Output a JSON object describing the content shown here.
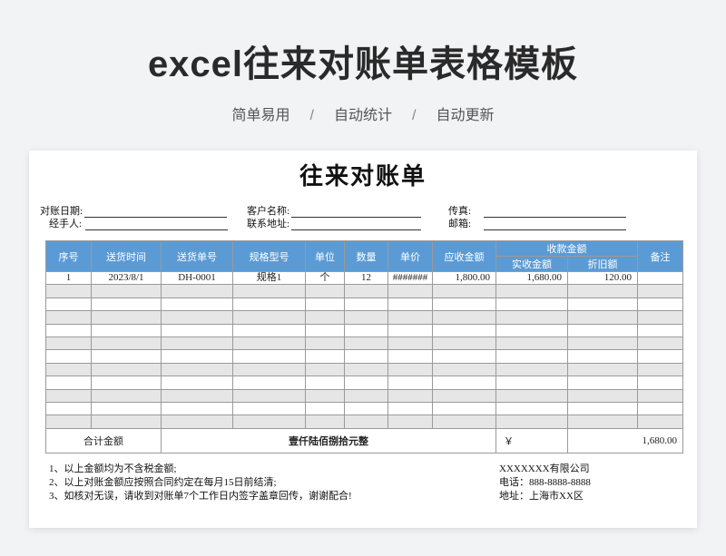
{
  "hero": {
    "title": "excel往来对账单表格模板",
    "tags": [
      "简单易用",
      "自动统计",
      "自动更新"
    ],
    "separator": "/"
  },
  "doc": {
    "title": "往来对账单",
    "fields": {
      "date_label": "对账日期:",
      "customer_label": "客户名称:",
      "fax_label": "传真:",
      "handler_label": "经手人:",
      "address_label": "联系地址:",
      "email_label": "邮箱:"
    }
  },
  "table": {
    "headers": {
      "index": "序号",
      "ship_time": "送货时间",
      "ship_no": "送货单号",
      "spec": "规格型号",
      "unit": "单位",
      "qty": "数量",
      "price": "单价",
      "receivable": "应收金额",
      "received_group": "收款金额",
      "actual": "实收金额",
      "discount": "折旧额",
      "remark": "备注"
    },
    "rows": [
      [
        "1",
        "2023/8/1",
        "DH-0001",
        "规格1",
        "个",
        "12",
        "#######",
        "1,800.00",
        "1,680.00",
        "120.00",
        ""
      ],
      [
        "",
        "",
        "",
        "",
        "",
        "",
        "",
        "",
        "",
        "",
        ""
      ],
      [
        "",
        "",
        "",
        "",
        "",
        "",
        "",
        "",
        "",
        "",
        ""
      ],
      [
        "",
        "",
        "",
        "",
        "",
        "",
        "",
        "",
        "",
        "",
        ""
      ],
      [
        "",
        "",
        "",
        "",
        "",
        "",
        "",
        "",
        "",
        "",
        ""
      ],
      [
        "",
        "",
        "",
        "",
        "",
        "",
        "",
        "",
        "",
        "",
        ""
      ],
      [
        "",
        "",
        "",
        "",
        "",
        "",
        "",
        "",
        "",
        "",
        ""
      ],
      [
        "",
        "",
        "",
        "",
        "",
        "",
        "",
        "",
        "",
        "",
        ""
      ],
      [
        "",
        "",
        "",
        "",
        "",
        "",
        "",
        "",
        "",
        "",
        ""
      ],
      [
        "",
        "",
        "",
        "",
        "",
        "",
        "",
        "",
        "",
        "",
        ""
      ],
      [
        "",
        "",
        "",
        "",
        "",
        "",
        "",
        "",
        "",
        "",
        ""
      ],
      [
        "",
        "",
        "",
        "",
        "",
        "",
        "",
        "",
        "",
        "",
        ""
      ]
    ],
    "total": {
      "label": "合计金额",
      "amount_words": "壹仟陆佰捌拾元整",
      "currency": "￥",
      "amount": "1,680.00"
    }
  },
  "notes": [
    "1、以上金额均为不含税金额;",
    "2、以上对账金额应按照合同约定在每月15日前结清;",
    "3、如核对无误，请收到对账单7个工作日内签字盖章回传，谢谢配合!"
  ],
  "company": {
    "name": "XXXXXXX有限公司",
    "phone": "电话：888-8888-8888",
    "address": "地址：上海市XX区"
  },
  "colors": {
    "header_blue": "#5b9bd5",
    "stripe_gray": "#e7e6e6"
  }
}
